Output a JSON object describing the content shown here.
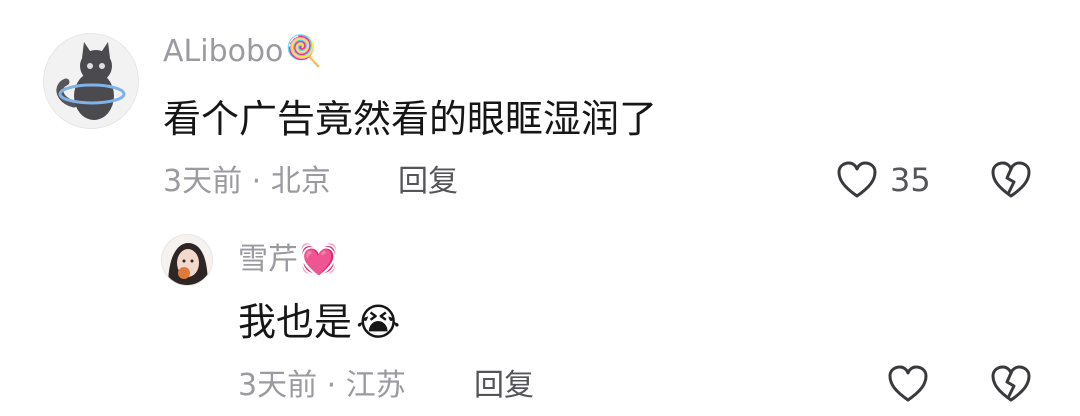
{
  "comment": {
    "username": "ALibobo",
    "username_emoji": "🍭",
    "text": "看个广告竟然看的眼眶湿润了",
    "meta": "3天前 · 北京",
    "reply_label": "回复",
    "like_count": "35",
    "avatar_icon": "cat-avatar-icon"
  },
  "reply": {
    "username": "雪芹",
    "username_emoji": "💓",
    "text": "我也是",
    "text_emoji": "😭",
    "meta": "3天前 · 江苏",
    "reply_label": "回复",
    "avatar_icon": "girl-avatar-icon"
  },
  "icons": {
    "like": "heart-outline-icon",
    "dislike": "broken-heart-icon"
  },
  "colors": {
    "username": "#9a9aa0",
    "text": "#161616",
    "icon_stroke": "#3a3a3e"
  }
}
